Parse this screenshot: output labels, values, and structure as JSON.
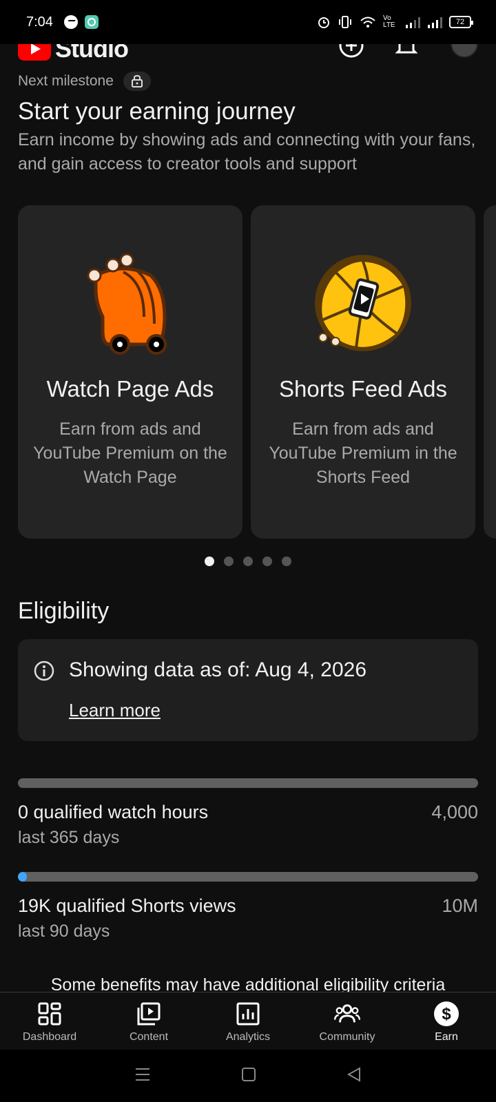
{
  "status_bar": {
    "time": "7:04",
    "battery": "72",
    "network_label": "Vo LTE"
  },
  "header": {
    "logo_text": "Studio"
  },
  "milestone": {
    "label": "Next milestone"
  },
  "earn": {
    "title": "Start your earning journey",
    "subtitle": "Earn income by showing ads and connecting with your fans, and gain access to creator tools and support"
  },
  "cards": [
    {
      "title": "Watch Page Ads",
      "description": "Earn from ads and YouTube Premium on the Watch Page"
    },
    {
      "title": "Shorts Feed Ads",
      "description": "Earn from ads and YouTube Premium in the Shorts Feed"
    }
  ],
  "pagination": {
    "count": 5,
    "active": 1
  },
  "eligibility": {
    "title": "Eligibility",
    "info_text": "Showing data as of: Aug 4, 2026",
    "learn_more": "Learn more",
    "metrics": [
      {
        "label": "0 qualified watch hours",
        "target": "4,000",
        "period": "last 365 days",
        "progress": 0
      },
      {
        "label": "19K qualified Shorts views",
        "target": "10M",
        "period": "last 90 days",
        "progress": 0.0019
      }
    ],
    "footer_note": "Some benefits may have additional eligibility criteria"
  },
  "nav": {
    "items": [
      {
        "label": "Dashboard",
        "icon": "dashboard-icon"
      },
      {
        "label": "Content",
        "icon": "content-icon"
      },
      {
        "label": "Analytics",
        "icon": "analytics-icon"
      },
      {
        "label": "Community",
        "icon": "community-icon"
      },
      {
        "label": "Earn",
        "icon": "earn-icon",
        "active": true
      }
    ]
  },
  "colors": {
    "accent": "#3ea6ff",
    "brand": "#ff0000",
    "background": "#0f0f0f"
  }
}
